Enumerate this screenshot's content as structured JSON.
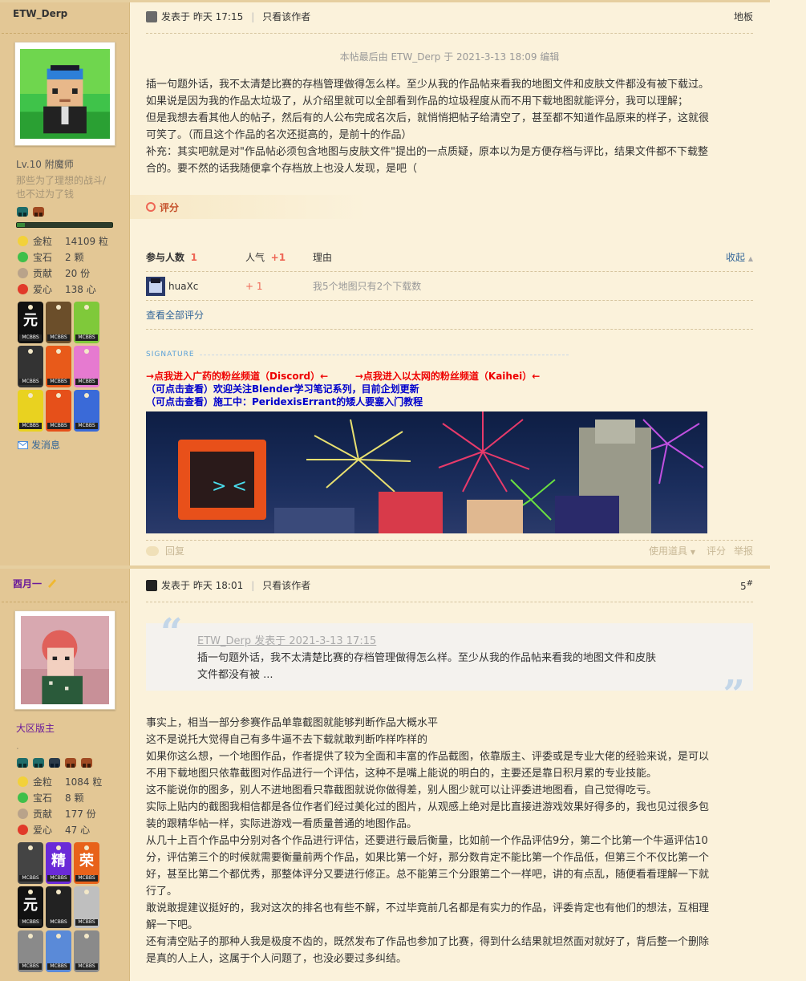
{
  "post1": {
    "author": "ETW_Derp",
    "level": "Lv.10 附魔师",
    "signature_text": "那些为了理想的战斗/也不过为了钱",
    "stats": [
      {
        "k": "金粒",
        "v": "14109 粒",
        "color": "#f2d13a"
      },
      {
        "k": "宝石",
        "v": "2 颗",
        "color": "#3fbf4a"
      },
      {
        "k": "贡献",
        "v": "20 份",
        "color": "#b9a38a"
      },
      {
        "k": "爱心",
        "v": "138 心",
        "color": "#e13a2a"
      }
    ],
    "send_message": "发消息",
    "posted_label": "发表于",
    "posted_time": "昨天 17:15",
    "only_author": "只看该作者",
    "floor": "地板",
    "edit_note": "本帖最后由 ETW_Derp 于 2021-3-13 18:09 编辑",
    "body": [
      "插一句题外话，我不太清楚比赛的存档管理做得怎么样。至少从我的作品帖来看我的地图文件和皮肤文件都没有被下载过。",
      "如果说是因为我的作品太垃圾了，从介绍里就可以全部看到作品的垃圾程度从而不用下载地图就能评分，我可以理解；",
      "但是我想去看其他人的帖子，然后有的人公布完成名次后，就悄悄把帖子给清空了，甚至都不知道作品原来的样子，这就很",
      "可笑了。（而且这个作品的名次还挺高的，是前十的作品）",
      "补充：其实吧就是对\"作品帖必须包含地图与皮肤文件\"提出的一点质疑，原本以为是方便存档与评比，结果文件都不下载整",
      "合的。要不然的话我随便拿个存档放上也没人发现，是吧（"
    ],
    "rating_title": "评分",
    "rating_headers": {
      "participants": "参与人数",
      "participants_count": "1",
      "popularity": "人气",
      "popularity_value": "+1",
      "reason": "理由",
      "collapse": "收起"
    },
    "rating_rows": [
      {
        "user": "huaXc",
        "score": "+ 1",
        "reason": "我5个地图只有2个下载数"
      }
    ],
    "view_all": "查看全部评分",
    "signature_label": "SIGNATURE",
    "sig_links": {
      "red1": "→点我进入广药的粉丝频道（Discord）←",
      "red2": "→点我进入以太网的粉丝频道（Kaihei）←",
      "blue1": "（可点击查看）欢迎关注Blender学习笔记系列，目前企划更新",
      "blue2": "（可点击查看）施工中：PeridexisErrant的矮人要塞入门教程"
    },
    "footer": {
      "reply": "回复",
      "use_item": "使用道具",
      "rate": "评分",
      "report": "举报"
    }
  },
  "post2": {
    "author": "酉月一",
    "level": "大区版主",
    "dot": ".",
    "stats": [
      {
        "k": "金粒",
        "v": "1084 粒",
        "color": "#f2d13a"
      },
      {
        "k": "宝石",
        "v": "8 颗",
        "color": "#3fbf4a"
      },
      {
        "k": "贡献",
        "v": "177 份",
        "color": "#b9a38a"
      },
      {
        "k": "爱心",
        "v": "47 心",
        "color": "#e13a2a"
      }
    ],
    "posted_label": "发表于",
    "posted_time": "昨天 18:01",
    "only_author": "只看该作者",
    "floor_num": "5",
    "floor_sup": "#",
    "quote_author": "ETW_Derp 发表于 2021-3-13 17:15",
    "quote_line1": "插一句题外话，我不太清楚比赛的存档管理做得怎么样。至少从我的作品帖来看我的地图文件和皮肤",
    "quote_line2": "文件都没有被 ...",
    "body": [
      "事实上，相当一部分参赛作品单靠截图就能够判断作品大概水平",
      "这不是说托大觉得自己有多牛逼不去下载就敢判断咋样咋样的",
      "如果你这么想，一个地图作品，作者提供了较为全面和丰富的作品截图，依靠版主、评委或是专业大佬的经验来说，是可以",
      "不用下载地图只依靠截图对作品进行一个评估，这种不是嘴上能说的明白的，主要还是靠日积月累的专业技能。",
      "这不能说你的图多，别人不进地图看只靠截图就说你做得差，别人图少就可以让评委进地图看，自己觉得吃亏。",
      "实际上贴内的截图我相信都是各位作者们经过美化过的图片，从观感上绝对是比直接进游戏效果好得多的，我也见过很多包",
      "装的跟精华帖一样，实际进游戏一看质量普通的地图作品。",
      "从几十上百个作品中分别对各个作品进行评估，还要进行最后衡量，比如前一个作品评估9分，第二个比第一个牛逼评估10",
      "分，评估第三个的时候就需要衡量前两个作品，如果比第一个好，那分数肯定不能比第一个作品低，但第三个不仅比第一个",
      "好，甚至比第二个都优秀，那整体评分又要进行修正。总不能第三个分跟第二个一样吧，讲的有点乱，随便看看理解一下就",
      "行了。",
      "敢说敢提建议挺好的，我对这次的排名也有些不解，不过毕竟前几名都是有实力的作品，评委肯定也有他们的想法，互相理",
      "解一下吧。",
      "还有清空贴子的那种人我是极度不齿的，既然发布了作品也参加了比赛，得到什么结果就坦然面对就好了，背后整一个删除",
      "是真的人上人，这属于个人问题了，也没必要过多纠结。"
    ]
  },
  "badges1": [
    {
      "bg": "#111",
      "c": "元",
      "tag": "MCBBS"
    },
    {
      "bg": "#6b4e2a",
      "c": "",
      "tag": "MCBBS"
    },
    {
      "bg": "#7fc93a",
      "c": "",
      "tag": "MCBBS"
    },
    {
      "bg": "#333",
      "c": "",
      "tag": "MCBBS"
    },
    {
      "bg": "#e85a1a",
      "c": "",
      "tag": "MCBBS"
    },
    {
      "bg": "#e67ad0",
      "c": "",
      "tag": "MCBBS"
    },
    {
      "bg": "#e9d220",
      "c": "",
      "tag": "MCBBS"
    },
    {
      "bg": "#e6501a",
      "c": "",
      "tag": "MCBBS"
    },
    {
      "bg": "#3a6ad8",
      "c": "",
      "tag": "MCBBS"
    }
  ],
  "badges2": [
    {
      "bg": "#444",
      "c": "",
      "tag": "MCBBS"
    },
    {
      "bg": "#6a2ad8",
      "c": "精",
      "tag": "MCBBS"
    },
    {
      "bg": "#e8621a",
      "c": "荣",
      "tag": "MCBBS"
    },
    {
      "bg": "#111",
      "c": "元",
      "tag": "MCBBS"
    },
    {
      "bg": "#222",
      "c": "",
      "tag": "MCBBS"
    },
    {
      "bg": "#bfbfbf",
      "c": "",
      "tag": "MCBBS"
    },
    {
      "bg": "#8a8a8a",
      "c": "",
      "tag": "MCBBS"
    },
    {
      "bg": "#5a8ad8",
      "c": "",
      "tag": "MCBBS"
    },
    {
      "bg": "#8a8a8a",
      "c": "",
      "tag": "MCBBS"
    }
  ]
}
